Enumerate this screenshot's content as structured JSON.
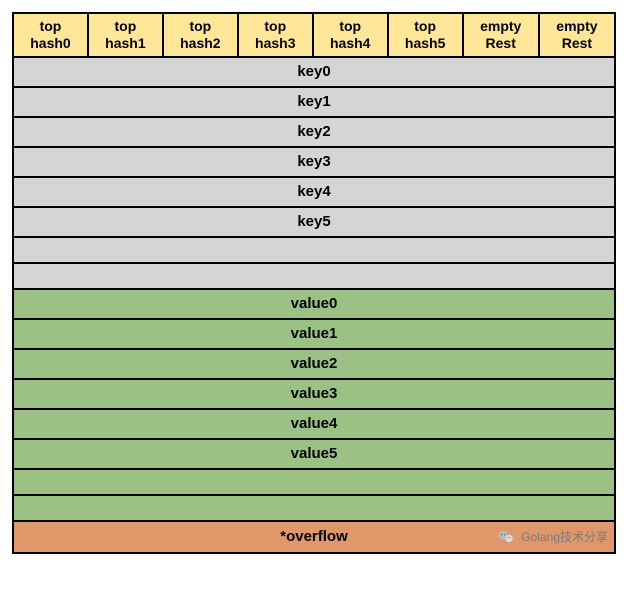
{
  "header": {
    "cells": [
      {
        "line1": "top",
        "line2": "hash0"
      },
      {
        "line1": "top",
        "line2": "hash1"
      },
      {
        "line1": "top",
        "line2": "hash2"
      },
      {
        "line1": "top",
        "line2": "hash3"
      },
      {
        "line1": "top",
        "line2": "hash4"
      },
      {
        "line1": "top",
        "line2": "hash5"
      },
      {
        "line1": "empty",
        "line2": "Rest"
      },
      {
        "line1": "empty",
        "line2": "Rest"
      }
    ]
  },
  "keys": [
    "key0",
    "key1",
    "key2",
    "key3",
    "key4",
    "key5",
    "",
    ""
  ],
  "values": [
    "value0",
    "value1",
    "value2",
    "value3",
    "value4",
    "value5",
    "",
    ""
  ],
  "overflow": {
    "label": "*overflow"
  },
  "watermark": {
    "text": "Golang技术分享"
  }
}
